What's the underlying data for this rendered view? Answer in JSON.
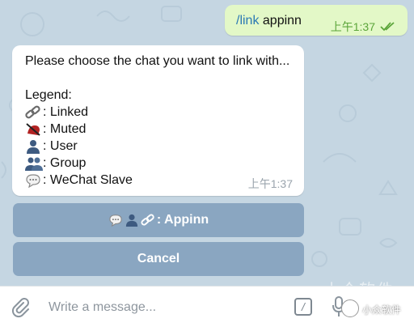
{
  "outgoing": {
    "command": "/link",
    "argument": " appinn",
    "time": "上午1:37"
  },
  "incoming": {
    "intro": "Please choose the chat you want to link with...",
    "legend_title": "Legend:",
    "legend": [
      {
        "icon": "link-icon",
        "text": ": Linked"
      },
      {
        "icon": "muted-icon",
        "text": ": Muted"
      },
      {
        "icon": "user-icon",
        "text": ": User"
      },
      {
        "icon": "group-icon",
        "text": ": Group"
      },
      {
        "icon": "speech-bubble-icon",
        "text": ": WeChat Slave"
      }
    ],
    "time": "上午1:37"
  },
  "keyboard": {
    "chat_button_label": ": Appinn",
    "cancel_label": "Cancel"
  },
  "input": {
    "placeholder": "Write a message..."
  },
  "watermark": {
    "text": "小众软件",
    "small_text": "小众软件"
  },
  "colors": {
    "outgoing_bubble": "#e3f8c7",
    "incoming_bubble": "#ffffff",
    "keyboard_button": "#8aa6c1",
    "command_link": "#2b79b4",
    "read_check": "#5ba53a",
    "chat_background": "#c5d6e2"
  }
}
